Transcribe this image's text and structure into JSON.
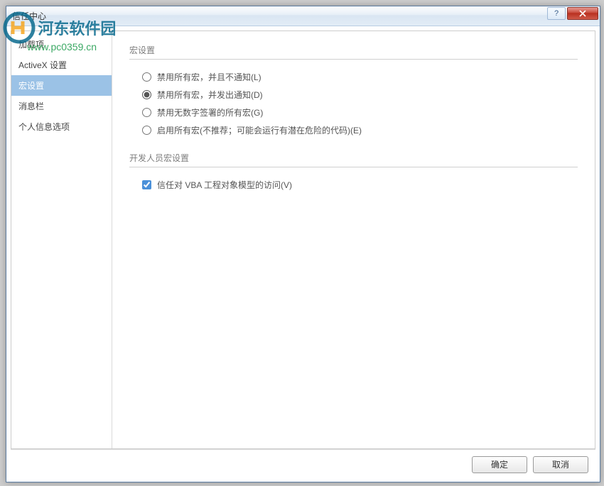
{
  "window": {
    "title": "信任中心"
  },
  "sidebar": {
    "items": [
      {
        "label": "加载项"
      },
      {
        "label": "ActiveX 设置"
      },
      {
        "label": "宏设置"
      },
      {
        "label": "消息栏"
      },
      {
        "label": "个人信息选项"
      }
    ],
    "selected_index": 2
  },
  "main": {
    "section1_title": "宏设置",
    "radios": [
      {
        "label": "禁用所有宏，并且不通知(L)",
        "key": "L",
        "checked": false
      },
      {
        "label": "禁用所有宏，并发出通知(D)",
        "key": "D",
        "checked": true
      },
      {
        "label": "禁用无数字签署的所有宏(G)",
        "key": "G",
        "checked": false
      },
      {
        "label": "启用所有宏(不推荐；可能会运行有潜在危险的代码)(E)",
        "key": "E",
        "checked": false
      }
    ],
    "section2_title": "开发人员宏设置",
    "checkbox": {
      "label": "信任对 VBA 工程对象模型的访问(V)",
      "key": "V",
      "checked": true
    }
  },
  "buttons": {
    "ok": "确定",
    "cancel": "取消"
  },
  "watermark": {
    "text1": "河东软件园",
    "text2": "www.pc0359.cn"
  }
}
